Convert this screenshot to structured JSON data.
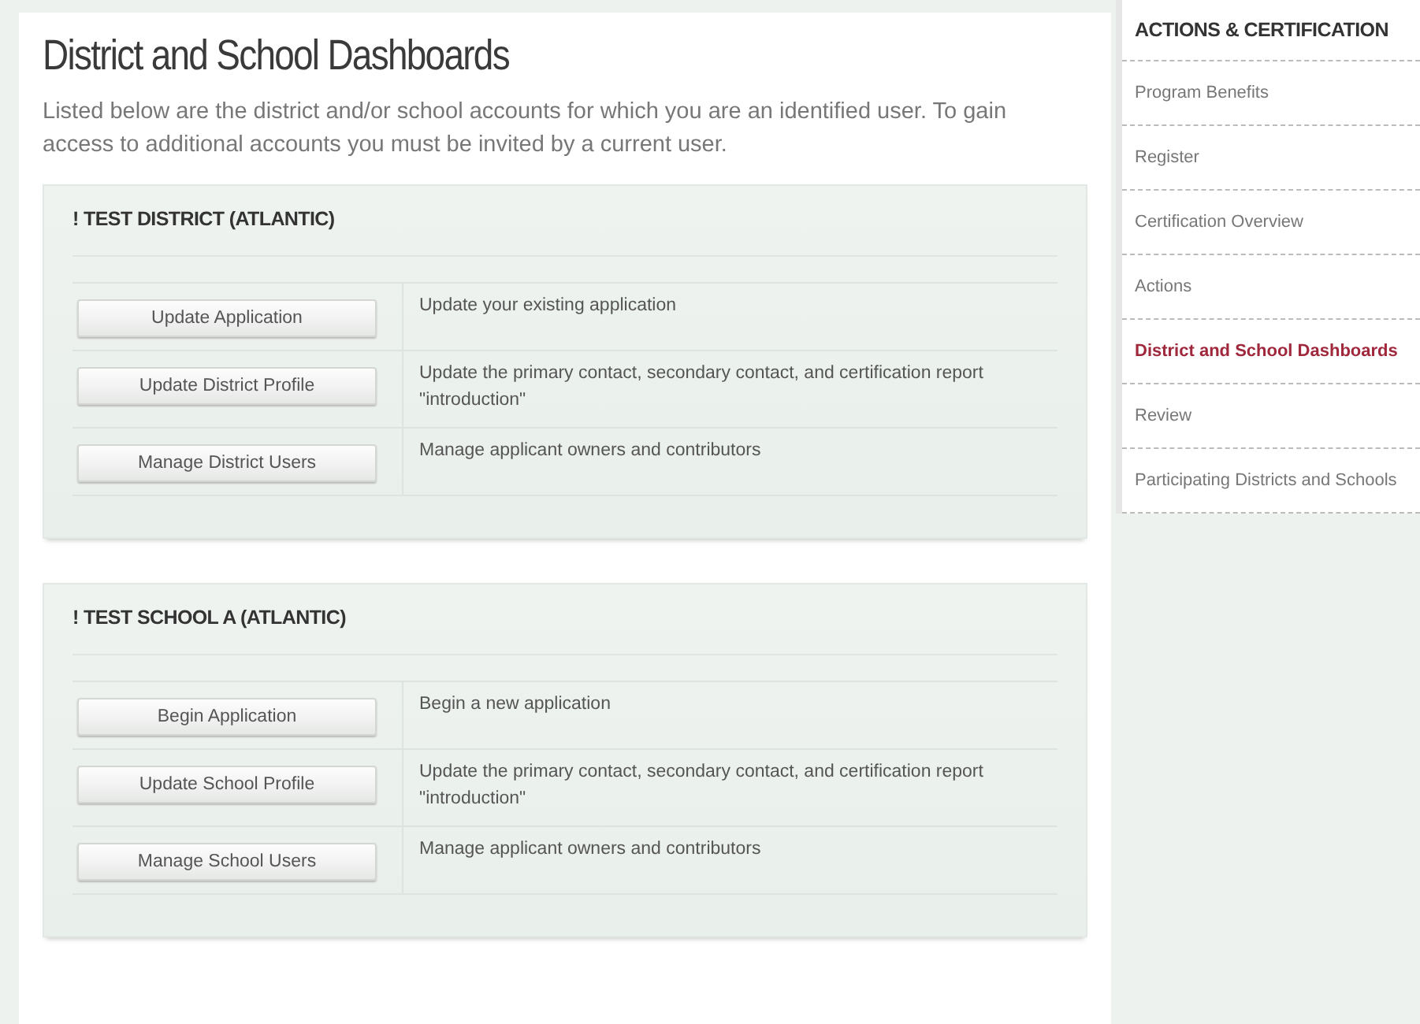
{
  "page": {
    "title": "District and School Dashboards",
    "intro": "Listed below are the district and/or school accounts for which you are an identified user. To gain access to additional accounts you must be invited by a current user."
  },
  "accounts": [
    {
      "name": "! TEST DISTRICT (ATLANTIC)",
      "actions": [
        {
          "button": "Update Application",
          "description": "Update your existing application"
        },
        {
          "button": "Update District Profile",
          "description": "Update the primary contact, secondary contact, and certification report \"introduction\""
        },
        {
          "button": "Manage District Users",
          "description": "Manage applicant owners and contributors"
        }
      ]
    },
    {
      "name": "! TEST SCHOOL A (ATLANTIC)",
      "actions": [
        {
          "button": "Begin Application",
          "description": "Begin a new application"
        },
        {
          "button": "Update School Profile",
          "description": "Update the primary contact, secondary contact, and certification report \"introduction\""
        },
        {
          "button": "Manage School Users",
          "description": "Manage applicant owners and contributors"
        }
      ]
    }
  ],
  "sidebar": {
    "title": "ACTIONS & CERTIFICATION",
    "items": [
      {
        "label": "Program Benefits",
        "selected": false
      },
      {
        "label": "Register",
        "selected": false
      },
      {
        "label": "Certification Overview",
        "selected": false
      },
      {
        "label": "Actions",
        "selected": false
      },
      {
        "label": "District and School Dashboards",
        "selected": true
      },
      {
        "label": "Review",
        "selected": false
      },
      {
        "label": "Participating Districts and Schools",
        "selected": false
      }
    ]
  }
}
